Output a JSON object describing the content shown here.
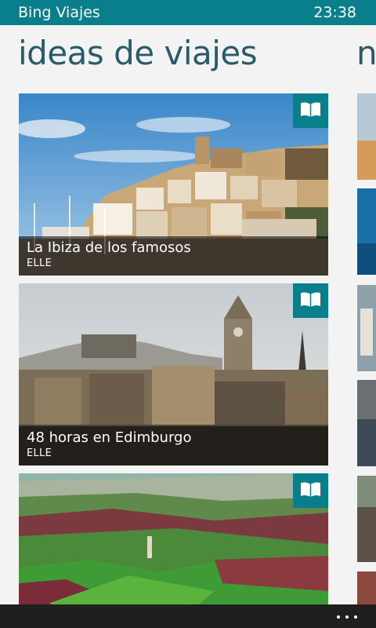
{
  "status_bar": {
    "app_title": "Bing Viajes",
    "clock": "23:38"
  },
  "page": {
    "title": "ideas de viajes",
    "next_title_peek": "n"
  },
  "cards": [
    {
      "title": "La Ibiza de los famosos",
      "source": "ELLE",
      "badge_icon": "book-icon"
    },
    {
      "title": "48 horas en Edimburgo",
      "source": "ELLE",
      "badge_icon": "book-icon"
    },
    {
      "title": "",
      "source": "",
      "badge_icon": "book-icon"
    }
  ],
  "app_bar": {
    "more_icon": "ellipsis-icon"
  },
  "colors": {
    "accent": "#0a7f8c",
    "title": "#2a5b6a",
    "background": "#f3f3f3",
    "app_bar": "#1f1f1f"
  }
}
